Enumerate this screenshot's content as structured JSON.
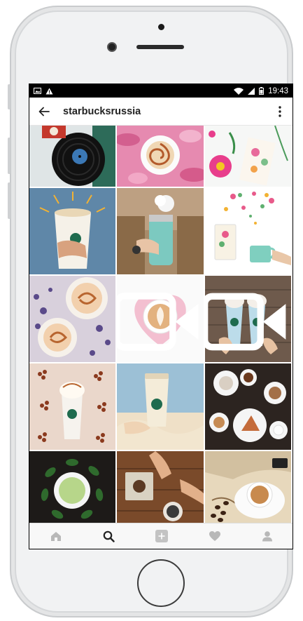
{
  "status_bar": {
    "time": "19:43",
    "icons": [
      "image-icon",
      "warning-icon",
      "wifi-icon",
      "signal-icon",
      "battery-icon"
    ]
  },
  "app_bar": {
    "back_icon": "arrow-left-icon",
    "username": "starbucksrussia",
    "menu_icon": "more-vertical-icon"
  },
  "feed": {
    "posts": [
      {
        "subject": "vinyl record and coffee cup",
        "media": "photo"
      },
      {
        "subject": "latte art with caramel drizzle on pink petals",
        "media": "photo"
      },
      {
        "subject": "flowers and coffee bag",
        "media": "photo"
      },
      {
        "subject": "hand holding cup with illustrated sun rays",
        "media": "photo"
      },
      {
        "subject": "teal tumbler with white flower",
        "media": "photo"
      },
      {
        "subject": "floral coffee bag and mug",
        "media": "photo"
      },
      {
        "subject": "caramel drinks on purple flowers",
        "media": "photo"
      },
      {
        "subject": "latte art heart with petals",
        "media": "video"
      },
      {
        "subject": "two frappuccino cups",
        "media": "video"
      },
      {
        "subject": "frappuccino on coffee beans pattern",
        "media": "photo"
      },
      {
        "subject": "cup and knit sweater",
        "media": "photo"
      },
      {
        "subject": "coffee and pastries table",
        "media": "photo"
      },
      {
        "subject": "matcha latte with leaves",
        "media": "photo"
      },
      {
        "subject": "hands with cookie and drink",
        "media": "photo"
      },
      {
        "subject": "coffee cup with beans on map",
        "media": "photo"
      }
    ]
  },
  "bottom_nav": {
    "items": [
      {
        "icon": "home-icon",
        "active": false
      },
      {
        "icon": "search-icon",
        "active": true
      },
      {
        "icon": "add-post-icon",
        "active": false
      },
      {
        "icon": "heart-icon",
        "active": false
      },
      {
        "icon": "profile-icon",
        "active": false
      }
    ]
  }
}
